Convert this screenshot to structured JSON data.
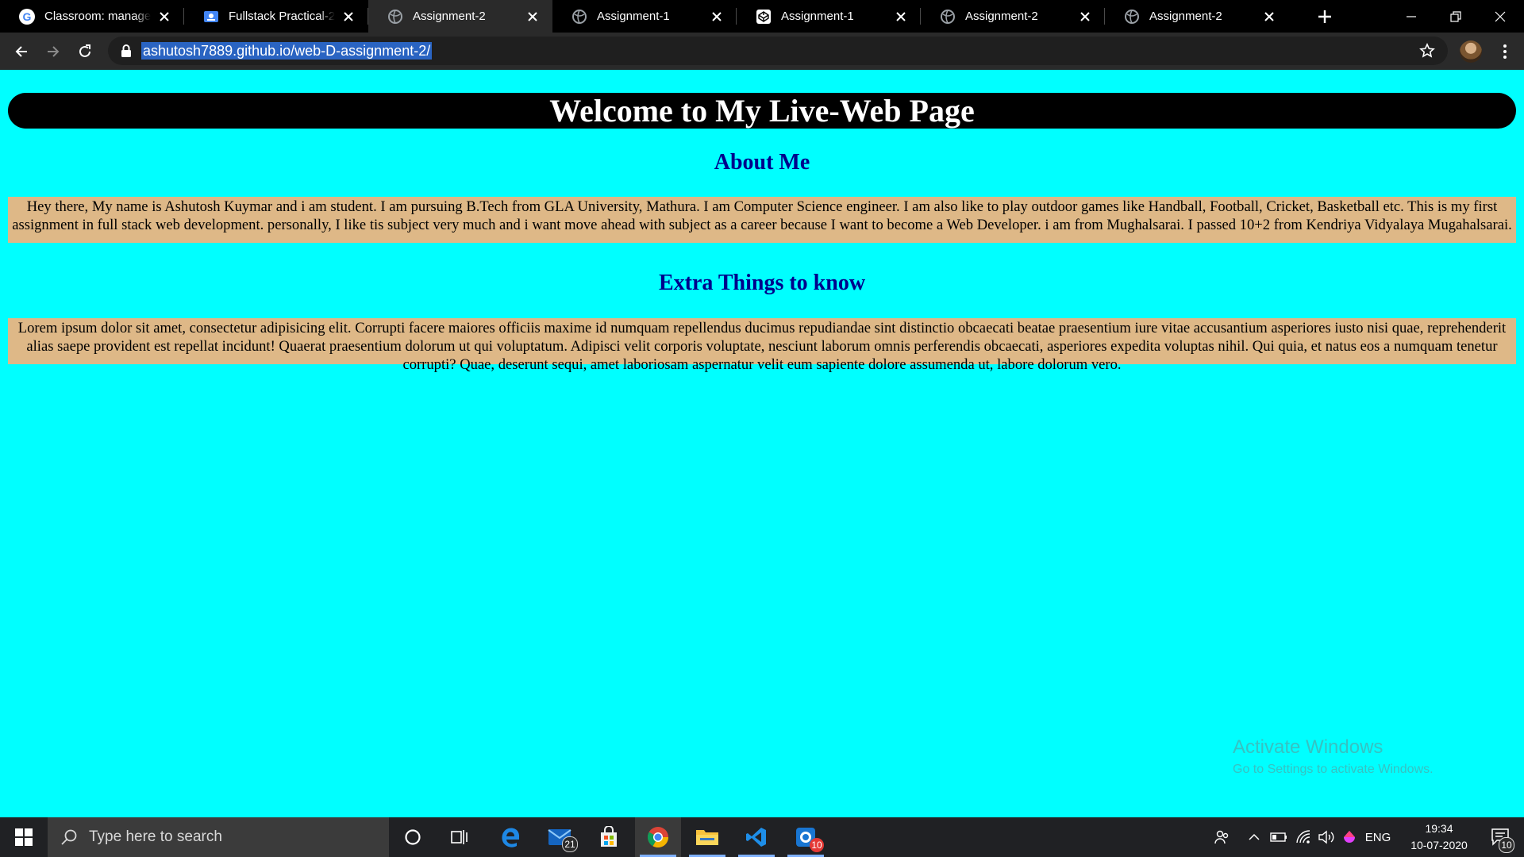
{
  "browser": {
    "tabs": [
      {
        "title": "Classroom: manage teachers",
        "icon": "google-g-icon",
        "active": false
      },
      {
        "title": "Fullstack Practical-2",
        "icon": "classroom-icon",
        "active": false
      },
      {
        "title": "Assignment-2",
        "icon": "globe-icon",
        "active": true
      },
      {
        "title": "Assignment-1",
        "icon": "globe-icon",
        "active": false
      },
      {
        "title": "Assignment-1",
        "icon": "codepen-icon",
        "active": false
      },
      {
        "title": "Assignment-2",
        "icon": "globe-icon",
        "active": false
      },
      {
        "title": "Assignment-2",
        "icon": "globe-icon",
        "active": false
      }
    ],
    "url": "ashutosh7889.github.io/web-D-assignment-2/"
  },
  "page": {
    "banner_title": "Welcome to My Live-Web Page",
    "about_heading": "About Me",
    "about_text": "Hey there, My name is Ashutosh Kuymar and i am student. I am pursuing B.Tech from GLA University, Mathura. I am Computer Science engineer. I am also like to play outdoor games like Handball, Football, Cricket, Basketball etc. This is my first assignment in full stack web development. personally, I like tis subject very much and i want move ahead with subject as a career because I want to become a Web Developer. i am from Mughalsarai. I passed 10+2 from Kendriya Vidyalaya Mugahalsarai.",
    "extra_heading": "Extra Things to know",
    "extra_text": "Lorem ipsum dolor sit amet, consectetur adipisicing elit. Corrupti facere maiores officiis maxime id numquam repellendus ducimus repudiandae sint distinctio obcaecati beatae praesentium iure vitae accusantium asperiores iusto nisi quae, reprehenderit alias saepe provident est repellat incidunt! Quaerat praesentium dolorum ut qui voluptatum. Adipisci velit corporis voluptate, nesciunt laborum omnis perferendis obcaecati, asperiores expedita voluptas nihil. Qui quia, et natus eos a numquam tenetur corrupti? Quae, deserunt sequi, amet laboriosam aspernatur velit eum sapiente dolore assumenda ut, labore dolorum vero.",
    "colors": {
      "background": "#00ffff",
      "banner": "#000000",
      "heading": "#00008b",
      "paragraph_bg": "#deb887"
    }
  },
  "watermark": {
    "title": "Activate Windows",
    "subtitle": "Go to Settings to activate Windows."
  },
  "taskbar": {
    "search_placeholder": "Type here to search",
    "mail_badge": "21",
    "app_badge": "10",
    "language": "ENG",
    "time": "19:34",
    "date": "10-07-2020",
    "notification_count": "10"
  }
}
